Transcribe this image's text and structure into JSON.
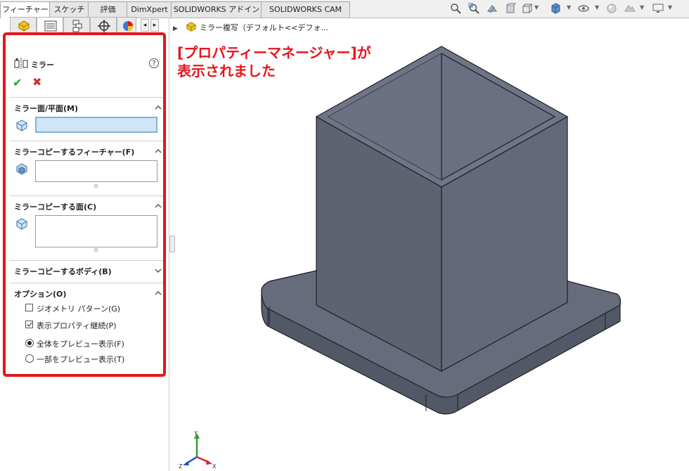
{
  "command_tabs": [
    {
      "label": "フィーチャー",
      "active": true
    },
    {
      "label": "スケッチ",
      "active": false
    },
    {
      "label": "評価",
      "active": false
    },
    {
      "label": "DimXpert",
      "active": false
    },
    {
      "label": "SOLIDWORKS アドイン",
      "active": false
    },
    {
      "label": "SOLIDWORKS CAM",
      "active": false
    }
  ],
  "heads_up_icons": [
    "zoom-to-fit-icon",
    "zoom-area-icon",
    "previous-view-icon",
    "section-view-icon",
    "view-orientation-icon",
    "display-style-icon",
    "hide-show-icon",
    "edit-appearance-icon",
    "apply-scene-icon",
    "view-settings-icon"
  ],
  "feature_tree": {
    "label": "ミラー複写（デフォルト<<デフォ..."
  },
  "property_manager": {
    "tabs": [
      "feature-manager-tab",
      "property-manager-tab",
      "configuration-manager-tab",
      "dimxpert-manager-tab",
      "display-manager-tab"
    ],
    "title": "ミラー",
    "help": "?",
    "sections": {
      "mirror_plane": {
        "title": "ミラー面/平面(M)"
      },
      "features": {
        "title": "ミラーコピーするフィーチャー(F)"
      },
      "faces": {
        "title": "ミラーコピーする面(C)"
      },
      "bodies": {
        "title": "ミラーコピーするボディ(B)"
      },
      "options": {
        "title": "オプション(O)",
        "geometry_pattern": {
          "label": "ジオメトリ パターン(G)",
          "checked": false
        },
        "propagate": {
          "label": "表示プロパティ継続(P)",
          "checked": true
        },
        "preview_full": {
          "label": "全体をプレビュー表示(F)",
          "selected": true
        },
        "preview_partial": {
          "label": "一部をプレビュー表示(T)",
          "selected": false
        }
      }
    }
  },
  "annotation": {
    "line1": "[プロパティーマネージャー]が",
    "line2": "表示されました",
    "color": "#e8141a"
  },
  "triad": {
    "x": "X",
    "y": "Y",
    "z": "Z"
  },
  "colors": {
    "model_face_front": "#626877",
    "model_face_side": "#5a5f6d",
    "model_top": "#6d7383",
    "accent_red": "#e8141a"
  }
}
